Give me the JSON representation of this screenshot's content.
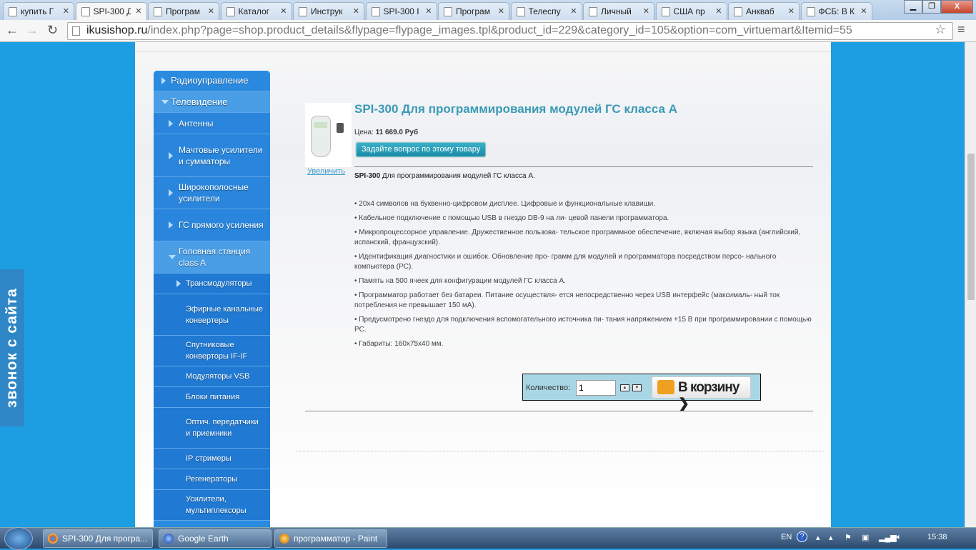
{
  "browser": {
    "tabs": [
      {
        "title": "купить Г",
        "icon": "yandex-icon"
      },
      {
        "title": "SPI-300 Д",
        "icon": "ikusi-icon",
        "active": true
      },
      {
        "title": "Програм",
        "icon": "page-icon"
      },
      {
        "title": "Каталог",
        "icon": "rainbow-icon"
      },
      {
        "title": "Инструк",
        "icon": "ut-icon"
      },
      {
        "title": "SPI-300 I",
        "icon": "page-icon"
      },
      {
        "title": "Програм",
        "icon": "phone-icon"
      },
      {
        "title": "Телеспу",
        "icon": "globe-icon"
      },
      {
        "title": "Личный",
        "icon": "dots-icon"
      },
      {
        "title": "США пр",
        "icon": "doc-icon"
      },
      {
        "title": "Анкваб",
        "icon": "doc-icon"
      },
      {
        "title": "ФСБ: В К",
        "icon": "doc-icon"
      }
    ],
    "url_host": "ikusishop.ru",
    "url_path": "/index.php?page=shop.product_details&flypage=flypage_images.tpl&product_id=229&category_id=105&option=com_virtuemart&Itemid=55"
  },
  "callback_widget": "звонок с сайта",
  "sidebar": {
    "items": [
      {
        "label": "Радиоуправление",
        "level": 1,
        "arrow": "right"
      },
      {
        "label": "Телевидение",
        "level": 1,
        "arrow": "down",
        "open": true
      },
      {
        "label": "Антенны",
        "level": 2,
        "arrow": "right"
      },
      {
        "label": "Мачтовые усилители и сумматоры",
        "level": 2,
        "arrow": "right"
      },
      {
        "label": "Широкополосные усилители",
        "level": 2,
        "arrow": "right"
      },
      {
        "label": "ГС прямого усиления",
        "level": 2,
        "arrow": "right"
      },
      {
        "label": "Головная станция class A",
        "level": 2,
        "arrow": "down",
        "open": true
      },
      {
        "label": "Трансмодуляторы",
        "level": 3,
        "arrow": "right"
      },
      {
        "label": "Эфирные канальные конвертеры",
        "level": 3
      },
      {
        "label": "Спутниковые конверторы IF-IF",
        "level": 3
      },
      {
        "label": "Модуляторы VSB",
        "level": 3
      },
      {
        "label": "Блоки питания",
        "level": 3
      },
      {
        "label": "Оптич. передатчики и приемники",
        "level": 3
      },
      {
        "label": "IP стримеры",
        "level": 3
      },
      {
        "label": "Регенераторы",
        "level": 3
      },
      {
        "label": "Усилители, мультиплексоры",
        "level": 3
      },
      {
        "label": "",
        "level": 1
      }
    ]
  },
  "product": {
    "title": "SPI-300 Для программирования модулей ГС класса А",
    "price_label": "Цена:",
    "price": "11 669.0 Руб",
    "ask_button": "Задайте вопрос по этому товару",
    "zoom_link": "Увеличить",
    "desc_bold": "SPI-300",
    "desc_rest": " Для программирования модулей ГС класса А.",
    "bullets": [
      "• 20x4 символов на буквенно-цифровом дисплее. Цифровые и функциональные клавиши.",
      "• Кабельное подключение с помощью USB в гнездо DB-9 на ли- цевой панели программатора.",
      "• Микропроцессорное управление. Дружественное пользова- тельское программное обеспечение, включая выбор языка (английский, испанский, французский).",
      "• Идентификация диагностики и ошибок. Обновление про- грамм для модулей и программатора посредством персо- нального компьютера (PC).",
      "• Память на 500 ячеек для конфигурации модулей ГС класса А.",
      "• Программатор работает без батареи. Питание осуществля- ется непосредственно через USB интерфейс (максималь- ный ток потребления не превышает 150 мА).",
      "• Предусмотрено гнездо для подключения вспомогательного источника пи- тания напряжением +15 В при программировании с помощью PC.",
      "• Габариты: 160x75x40 мм."
    ],
    "quantity_label": "Количество:",
    "quantity": "1",
    "cart_button": "В корзину ❯"
  },
  "taskbar": {
    "items": [
      "SPI-300 Для програ...",
      "Google Earth",
      "программатор - Paint"
    ],
    "lang": "EN",
    "time": "15:38"
  }
}
